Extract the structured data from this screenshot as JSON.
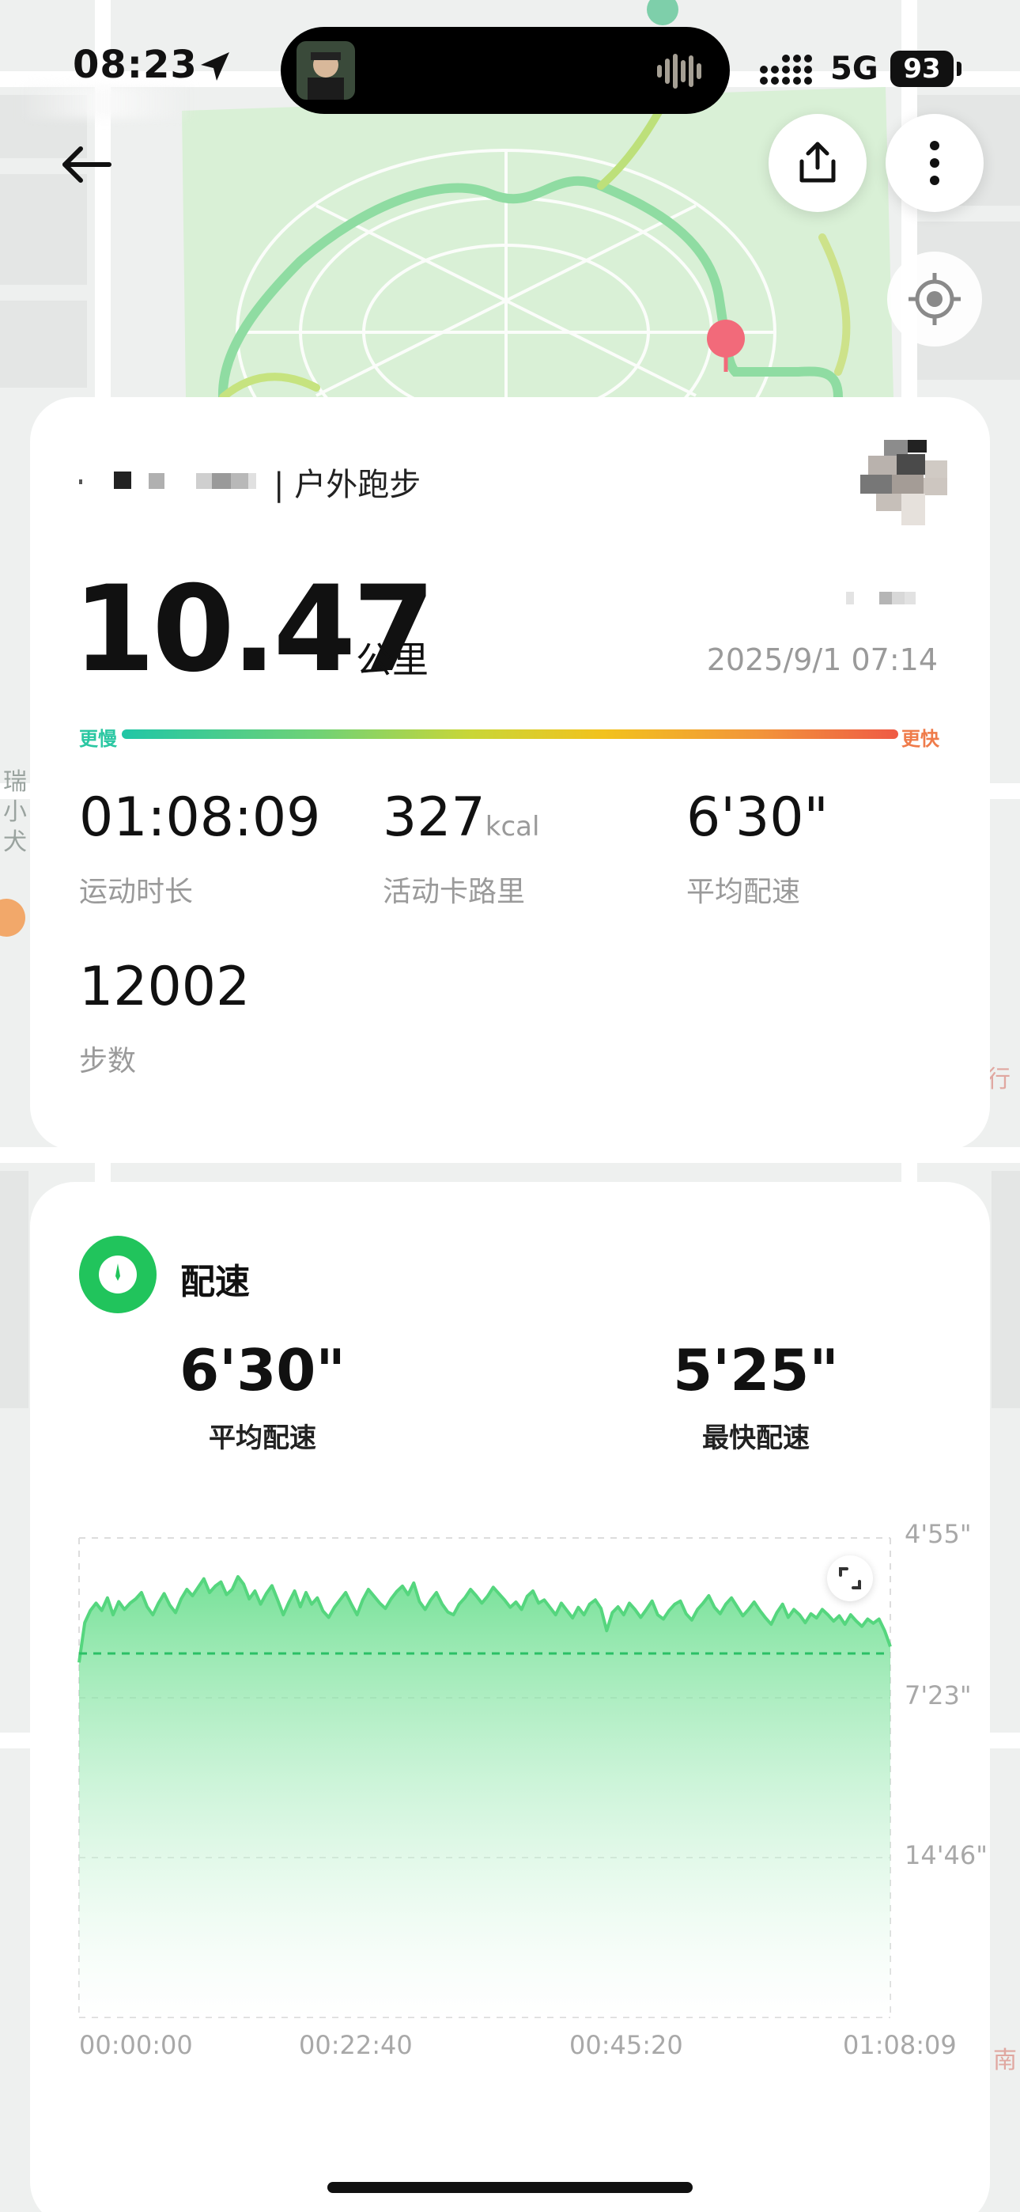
{
  "status_bar": {
    "time": "08:23",
    "network": "5G",
    "battery": "93"
  },
  "header": {
    "activity_type": "| 户外跑步"
  },
  "summary": {
    "distance": "10.47",
    "distance_unit": "公里",
    "datetime": "2025/9/1 07:14",
    "gradient": {
      "slower": "更慢",
      "faster": "更快"
    },
    "stats": [
      {
        "value": "01:08:09",
        "unit": "",
        "label": "运动时长"
      },
      {
        "value": "327",
        "unit": "kcal",
        "label": "活动卡路里"
      },
      {
        "value": "6'30\"",
        "unit": "",
        "label": "平均配速"
      },
      {
        "value": "12002",
        "unit": "",
        "label": "步数"
      }
    ]
  },
  "pace": {
    "title": "配速",
    "avg_value": "6'30\"",
    "avg_label": "平均配速",
    "best_value": "5'25\"",
    "best_label": "最快配速"
  },
  "colors": {
    "accent": "#21c45c",
    "route": "#7ddc9c",
    "pin": "#f26a7a"
  },
  "chart_data": {
    "type": "area",
    "y_ticks": [
      "4'55\"",
      "7'23\"",
      "14'46\""
    ],
    "x_ticks": [
      "00:00:00",
      "00:22:40",
      "00:45:20",
      "01:08:09"
    ],
    "avg_line": "6'30\"",
    "pace_seconds_per_km": [
      530,
      455,
      432,
      418,
      432,
      408,
      440,
      415,
      430,
      418,
      410,
      398,
      425,
      440,
      418,
      400,
      422,
      436,
      410,
      392,
      404,
      388,
      372,
      398,
      386,
      378,
      402,
      392,
      368,
      382,
      410,
      395,
      420,
      400,
      385,
      412,
      440,
      416,
      395,
      425,
      398,
      420,
      408,
      433,
      445,
      426,
      412,
      398,
      420,
      440,
      412,
      392,
      405,
      418,
      428,
      410,
      396,
      386,
      402,
      380,
      415,
      430,
      412,
      398,
      420,
      435,
      440,
      420,
      408,
      392,
      404,
      418,
      405,
      388,
      400,
      412,
      426,
      416,
      430,
      405,
      395,
      418,
      412,
      426,
      440,
      418,
      432,
      446,
      426,
      440,
      420,
      412,
      428,
      470,
      436,
      425,
      440,
      418,
      430,
      445,
      430,
      414,
      440,
      448,
      432,
      420,
      414,
      438,
      450,
      430,
      418,
      404,
      426,
      438,
      420,
      408,
      425,
      442,
      430,
      416,
      432,
      446,
      458,
      436,
      420,
      445,
      430,
      440,
      455,
      438,
      446,
      430,
      440,
      452,
      442,
      458,
      440,
      452,
      462,
      448,
      456,
      448,
      470,
      500
    ]
  }
}
